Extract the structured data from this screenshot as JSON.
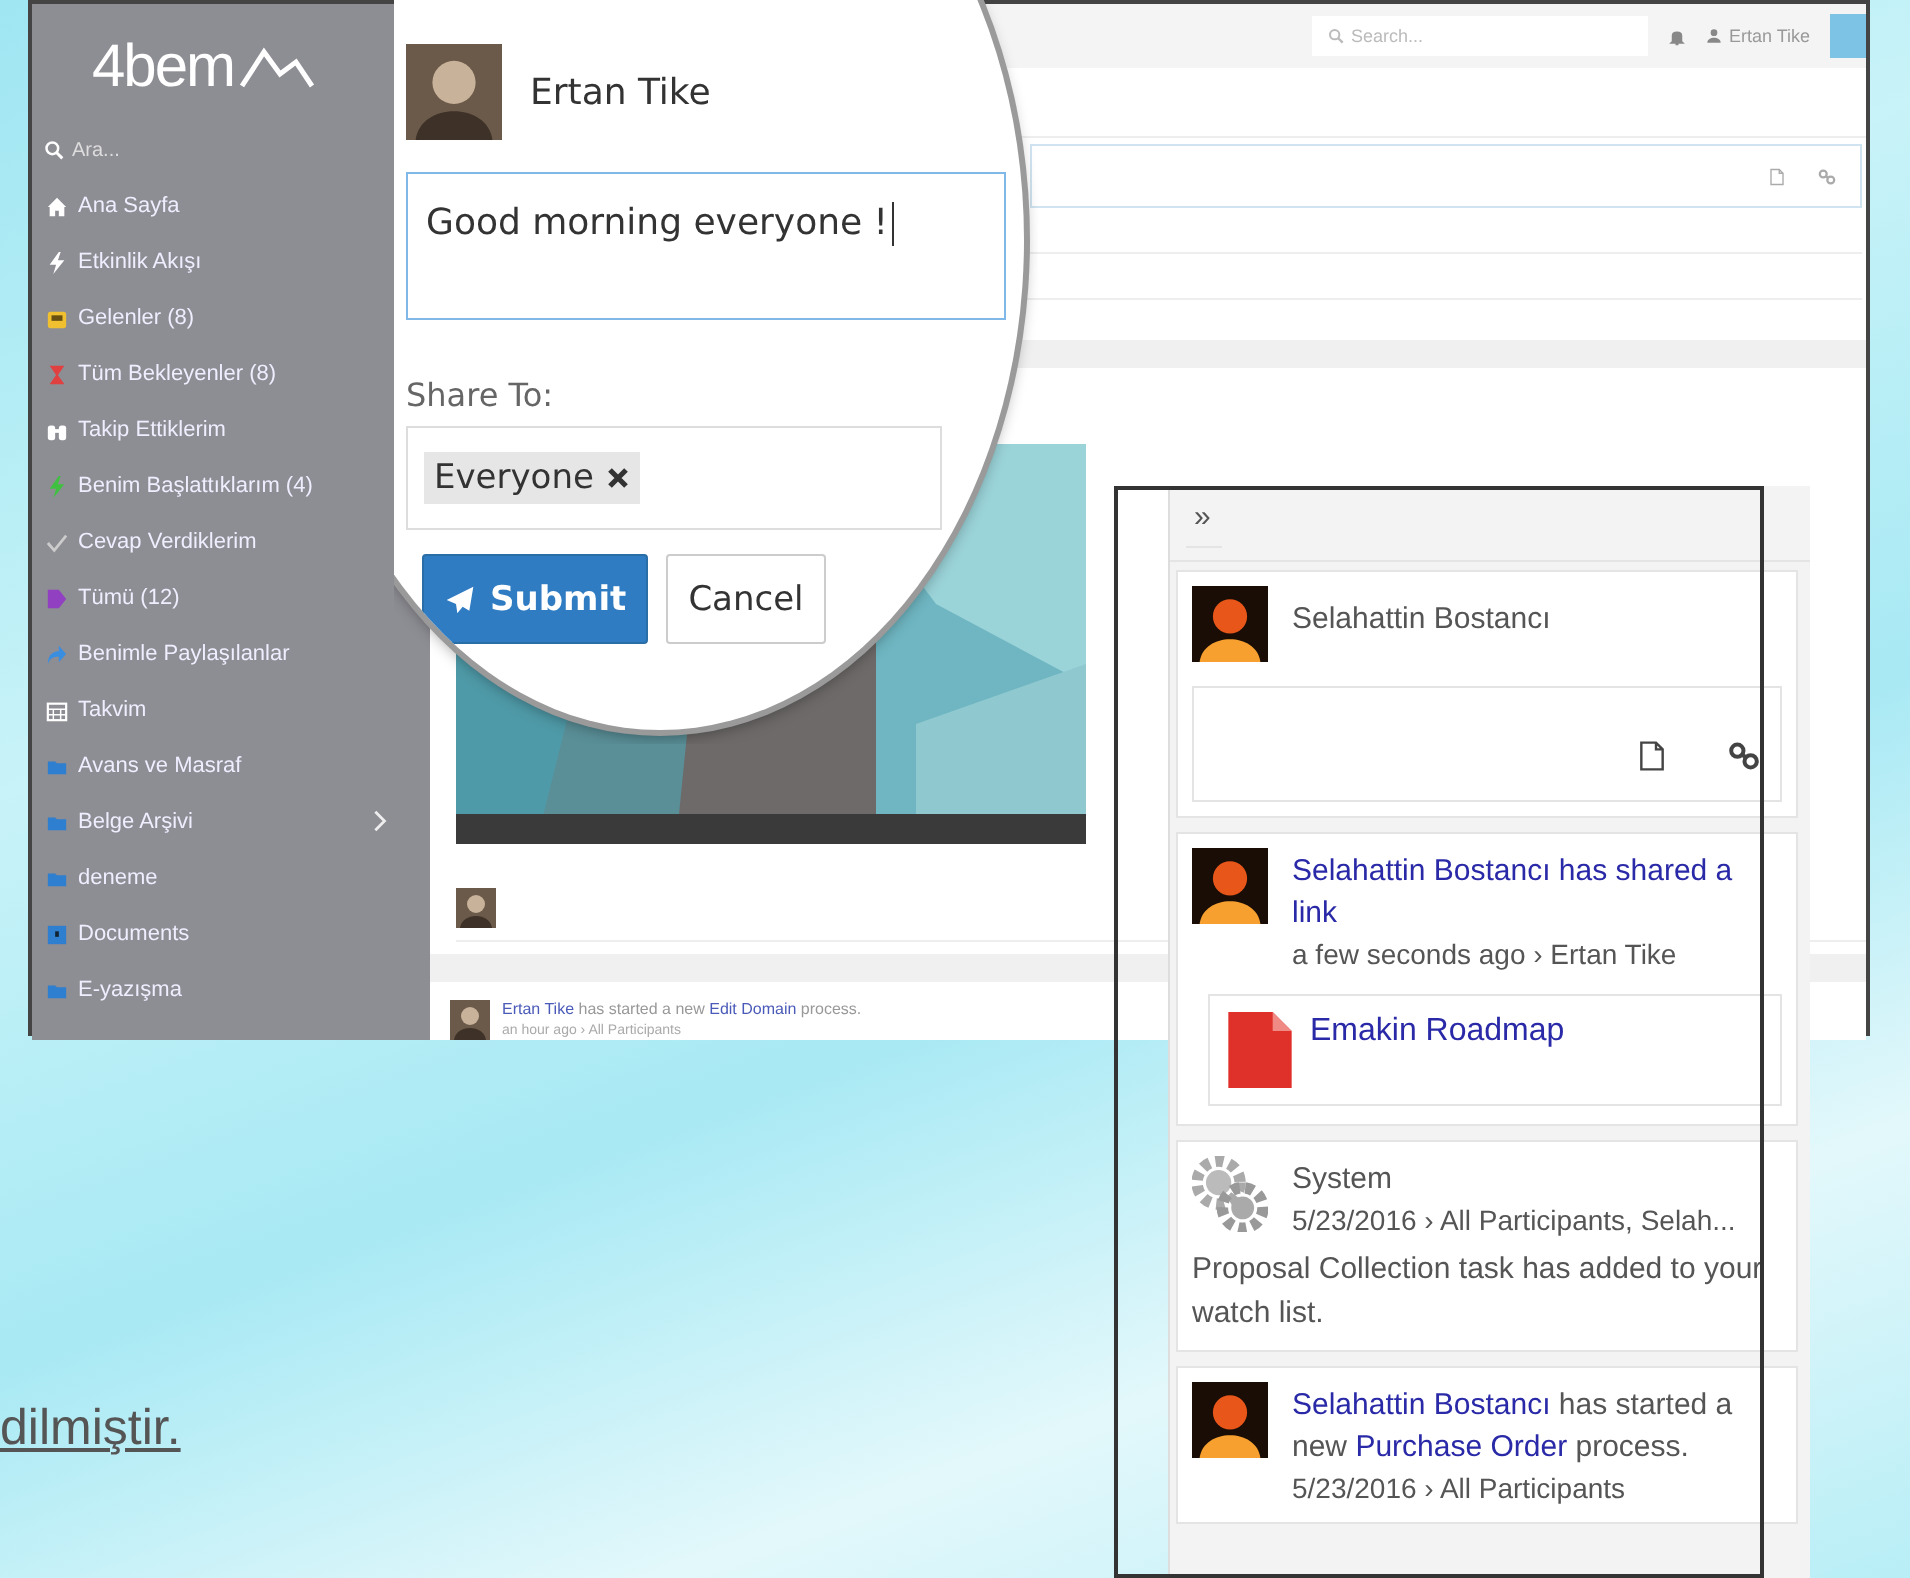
{
  "sidebar": {
    "logo": "4bem",
    "search": {
      "placeholder": "Ara..."
    },
    "items": [
      {
        "label": "Ana Sayfa",
        "submenu": false
      },
      {
        "label": "Etkinlik Akışı",
        "submenu": false
      },
      {
        "label": "Gelenler (8)",
        "submenu": false
      },
      {
        "label": "Tüm Bekleyenler (8)",
        "submenu": false
      },
      {
        "label": "Takip Ettiklerim",
        "submenu": false
      },
      {
        "label": "Benim Başlattıklarım (4)",
        "submenu": false
      },
      {
        "label": "Cevap Verdiklerim",
        "submenu": false
      },
      {
        "label": "Tümü (12)",
        "submenu": false
      },
      {
        "label": "Benimle Paylaşılanlar",
        "submenu": false
      },
      {
        "label": "Takvim",
        "submenu": false
      },
      {
        "label": "Avans ve Masraf",
        "submenu": false
      },
      {
        "label": "Belge Arşivi",
        "submenu": true
      },
      {
        "label": "deneme",
        "submenu": false
      },
      {
        "label": "Documents",
        "submenu": false
      },
      {
        "label": "E-yazışma",
        "submenu": false
      }
    ]
  },
  "topbar": {
    "search": {
      "placeholder": "Search..."
    },
    "user": "Ertan Tike"
  },
  "feed": [
    {
      "parts": [
        {
          "text": "Ertan Tike",
          "link": true
        },
        {
          "text": " has started a new ",
          "link": false
        },
        {
          "text": "Edit Domain",
          "link": true
        },
        {
          "text": " process.",
          "link": false
        }
      ],
      "meta": "an hour ago › All Participants"
    }
  ],
  "magnifier": {
    "author": "Ertan Tike",
    "post": {
      "value": "Good morning everyone !"
    },
    "share_label": "Share To:",
    "share_tags": [
      "Everyone"
    ],
    "buttons": [
      {
        "label": "Submit",
        "kind": "primary"
      },
      {
        "label": "Cancel",
        "kind": "default"
      }
    ]
  },
  "panel": {
    "toggle": "»",
    "composer": {
      "author": "Selahattin Bostancı"
    },
    "items": [
      {
        "kind": "share",
        "parts": [
          {
            "text": "Selahattin Bostancı has shared a link",
            "link": true
          }
        ],
        "meta": "a few seconds ago › Ertan Tike",
        "attachment": "Emakin Roadmap"
      },
      {
        "kind": "system",
        "title": "System",
        "meta": "5/23/2016 › All Participants, Selah...",
        "body": "Proposal Collection task has added to your watch list."
      },
      {
        "kind": "process",
        "parts": [
          {
            "text": "Selahattin Bostancı",
            "link": true
          },
          {
            "text": " has started a new ",
            "link": false
          },
          {
            "text": "Purchase Order",
            "link": true
          },
          {
            "text": " process.",
            "link": false
          }
        ],
        "meta": "5/23/2016 › All Participants"
      }
    ]
  },
  "caption": "dilmiştir."
}
